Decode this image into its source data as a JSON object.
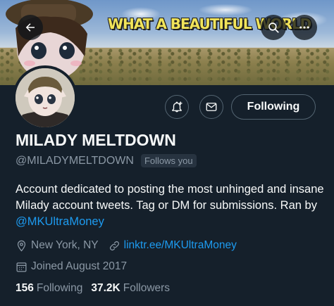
{
  "header": {
    "banner_text": "WHAT A BEAUTIFUL WORLD"
  },
  "profile": {
    "display_name": "MILADY MELTDOWN",
    "handle": "@MILADYMELTDOWN",
    "follows_you": "Follows you",
    "bio_text": "Account dedicated to posting the most unhinged and insane Milady account tweets. Tag or DM for submissions. Ran by ",
    "bio_mention": "@MKUltraMoney",
    "location": "New York, NY",
    "website": "linktr.ee/MKUltraMoney",
    "joined": "Joined August 2017",
    "following_count": "156",
    "following_label": "Following",
    "followers_count": "37.2K",
    "followers_label": "Followers"
  },
  "actions": {
    "follow_state": "Following"
  },
  "icons": {
    "back": "arrow-left-icon",
    "search": "search-icon",
    "more": "more-icon",
    "notify": "bell-plus-icon",
    "message": "envelope-icon",
    "location": "location-pin-icon",
    "link": "link-icon",
    "calendar": "calendar-icon"
  },
  "colors": {
    "background": "#15202b",
    "accent": "#1d9bf0",
    "secondary_text": "#8b98a5",
    "border": "#536471"
  }
}
